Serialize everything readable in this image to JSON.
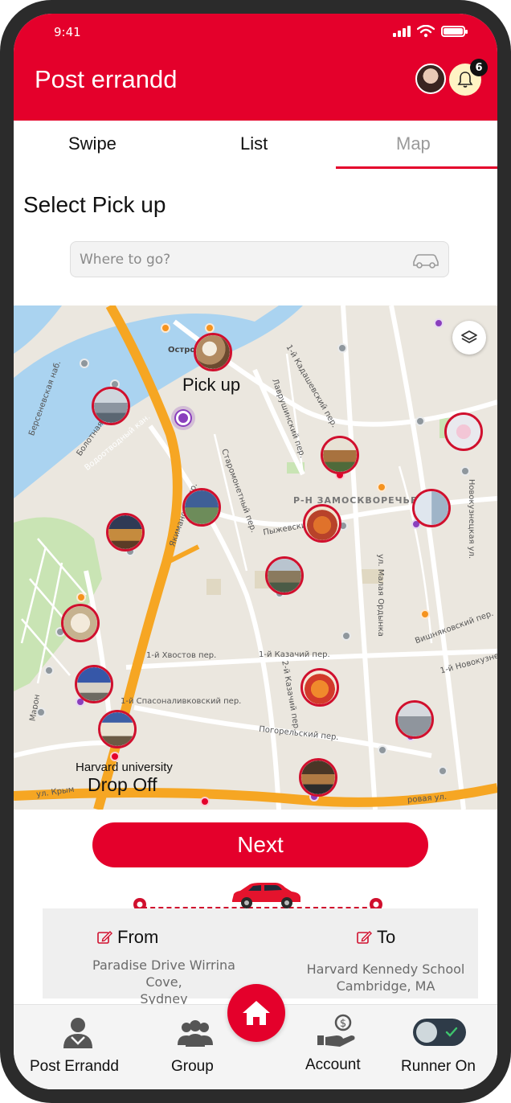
{
  "status_bar": {
    "time": "9:41"
  },
  "header": {
    "title": "Post errandd",
    "notification_count": "6"
  },
  "tabs": [
    {
      "label": "Swipe",
      "active": false
    },
    {
      "label": "List",
      "active": false
    },
    {
      "label": "Map",
      "active": true
    }
  ],
  "page": {
    "section_title": "Select Pick up",
    "search_placeholder": "Where to go?"
  },
  "map": {
    "pickup_label": "Pick up",
    "dropoff_place": "Harvard university",
    "dropoff_label": "Drop Off",
    "streets": {
      "s1": "Остров",
      "s2": "Р-Н ЗАМОСКВОРЕЧЬЕ",
      "s3": "1-й Хвостов пер.",
      "s4": "1-й Казачий пер.",
      "s5": "1-й Спасоналивковский пер.",
      "s6": "Погорельский пер.",
      "s7": "Пыжевский пер.",
      "s8": "Вишняковский пер.",
      "s9": "1-й Новокузне",
      "s10": "Якиманский пр.",
      "s11": "ул. Малая Ордынка",
      "s12": "Новокузнецкая ул.",
      "s13": "Водоотводный кан.",
      "s14": "Берсеневская наб.",
      "s15": "Старомонетный пер.",
      "s16": "Лаврушинский пер.",
      "s17": "1-й Кадашевский пер.",
      "s18": "2-й Казачий пер.",
      "s19": "Болотная наб.",
      "s20": "ул. Крым",
      "s21": "Марон",
      "s22": "ровая ул."
    }
  },
  "actions": {
    "next_label": "Next"
  },
  "route": {
    "from_label": "From",
    "from_address_line1": "Paradise Drive Wirrina Cove,",
    "from_address_line2": "Sydney",
    "to_label": "To",
    "to_address_line1": "Harvard Kennedy School",
    "to_address_line2": "Cambridge, MA"
  },
  "bottom_nav": {
    "items": [
      {
        "label": "Post Errandd",
        "icon": "person-icon"
      },
      {
        "label": "Group",
        "icon": "group-icon"
      },
      {
        "label": "Home",
        "icon": "home-icon"
      },
      {
        "label": "Account",
        "icon": "account-icon"
      },
      {
        "label": "Runner On",
        "icon": "toggle-icon"
      }
    ]
  },
  "colors": {
    "accent": "#e4002b",
    "map_bg": "#ebe7df",
    "road": "#f6a623"
  }
}
